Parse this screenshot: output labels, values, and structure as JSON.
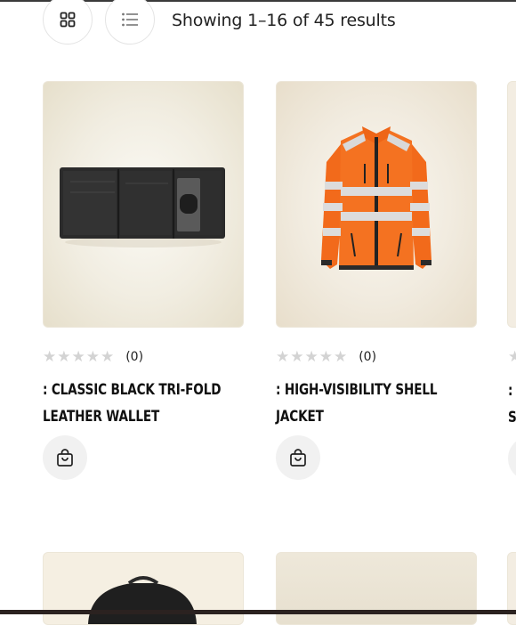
{
  "toolbar": {
    "grid_view_icon": "grid-icon",
    "list_view_icon": "list-icon",
    "results_text": "Showing 1–16 of 45 results"
  },
  "products": [
    {
      "title_line1": ": CLASSIC BLACK TRI-FOLD",
      "title_line2": "LEATHER WALLET",
      "stars": "★★★★★",
      "rating_count": "(0)",
      "image": "black-wallet"
    },
    {
      "title_line1": ": HIGH-VISIBILITY SHELL",
      "title_line2": "JACKET",
      "stars": "★★★★★",
      "rating_count": "(0)",
      "image": "orange-hi-vis-jacket"
    }
  ],
  "peek": {
    "star": "★",
    "title_line1": ":",
    "title_line2": "S"
  },
  "colors": {
    "star_empty": "#d3d3d3",
    "cart_button_bg": "#f1f1f1",
    "jacket_orange": "#f26a1b"
  }
}
